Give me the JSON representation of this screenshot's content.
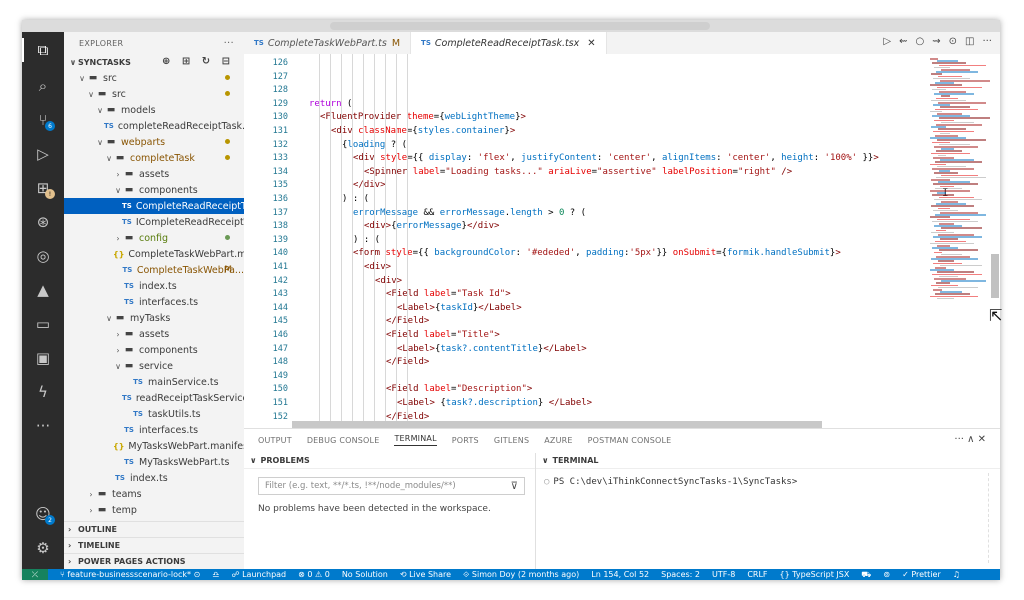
{
  "explorer": {
    "header": "EXPLORER",
    "more": "···",
    "root_label": "SYNCTASKS",
    "root_actions": "⊕ ⊞ ↻ ⊟",
    "tree": [
      {
        "label": "src",
        "depth": 1,
        "kind": "folder",
        "open": true,
        "mod": "dot"
      },
      {
        "label": "src",
        "depth": 2,
        "kind": "folder",
        "open": true,
        "mod": "dot"
      },
      {
        "label": "models",
        "depth": 3,
        "kind": "folder",
        "open": true
      },
      {
        "label": "completeReadReceiptTask.ts",
        "depth": 4,
        "kind": "ts"
      },
      {
        "label": "webparts",
        "depth": 3,
        "kind": "folder",
        "open": true,
        "mod": "dot",
        "color": "gold"
      },
      {
        "label": "completeTask",
        "depth": 4,
        "kind": "folder",
        "open": true,
        "mod": "dot",
        "color": "gold"
      },
      {
        "label": "assets",
        "depth": 5,
        "kind": "folder",
        "open": false
      },
      {
        "label": "components",
        "depth": 5,
        "kind": "folder",
        "open": true
      },
      {
        "label": "CompleteReadReceiptTas...",
        "depth": 6,
        "kind": "ts",
        "selected": true
      },
      {
        "label": "ICompleteReadReceiptTa...",
        "depth": 6,
        "kind": "ts"
      },
      {
        "label": "config",
        "depth": 5,
        "kind": "folder",
        "open": false,
        "mod": "green",
        "color": "greenish"
      },
      {
        "label": "CompleteTaskWebPart.ma...",
        "depth": 5,
        "kind": "json"
      },
      {
        "label": "CompleteTaskWebPa...",
        "depth": 5,
        "kind": "ts",
        "mod": "M",
        "color": "gold"
      },
      {
        "label": "index.ts",
        "depth": 5,
        "kind": "ts"
      },
      {
        "label": "interfaces.ts",
        "depth": 5,
        "kind": "ts"
      },
      {
        "label": "myTasks",
        "depth": 4,
        "kind": "folder",
        "open": true
      },
      {
        "label": "assets",
        "depth": 5,
        "kind": "folder",
        "open": false
      },
      {
        "label": "components",
        "depth": 5,
        "kind": "folder",
        "open": false
      },
      {
        "label": "service",
        "depth": 5,
        "kind": "folder",
        "open": true
      },
      {
        "label": "mainService.ts",
        "depth": 6,
        "kind": "ts"
      },
      {
        "label": "readReceiptTaskService.ts",
        "depth": 6,
        "kind": "ts"
      },
      {
        "label": "taskUtils.ts",
        "depth": 6,
        "kind": "ts"
      },
      {
        "label": "interfaces.ts",
        "depth": 5,
        "kind": "ts"
      },
      {
        "label": "MyTasksWebPart.manifest...",
        "depth": 5,
        "kind": "json"
      },
      {
        "label": "MyTasksWebPart.ts",
        "depth": 5,
        "kind": "ts"
      },
      {
        "label": "index.ts",
        "depth": 4,
        "kind": "ts"
      },
      {
        "label": "teams",
        "depth": 2,
        "kind": "folder",
        "open": false
      },
      {
        "label": "temp",
        "depth": 2,
        "kind": "folder",
        "open": false
      }
    ],
    "sections": [
      "OUTLINE",
      "TIMELINE",
      "POWER PAGES ACTIONS"
    ]
  },
  "tabs": [
    {
      "label": "CompleteTaskWebPart.ts",
      "badge": "TS",
      "modified": "M",
      "active": false
    },
    {
      "label": "CompleteReadReceiptTask.tsx",
      "badge": "TS",
      "close": "✕",
      "active": true
    }
  ],
  "tab_actions": [
    "▷",
    "⇜",
    "○",
    "⇝",
    "⊙",
    "◫",
    "···"
  ],
  "editor": {
    "lines": [
      {
        "n": "126",
        "indent": 0,
        "tokens": []
      },
      {
        "n": "127",
        "indent": 0,
        "tokens": []
      },
      {
        "n": "128",
        "indent": 0,
        "tokens": []
      },
      {
        "n": "129",
        "indent": 1,
        "tokens": [
          [
            "kw",
            "return"
          ],
          [
            "p",
            " ("
          ]
        ]
      },
      {
        "n": "130",
        "indent": 2,
        "tokens": [
          [
            "tag",
            "<FluentProvider"
          ],
          [
            "attr",
            " theme"
          ],
          [
            "p",
            "={"
          ],
          [
            "var",
            "webLightTheme"
          ],
          [
            "p",
            "}"
          ],
          [
            "tag",
            ">"
          ]
        ]
      },
      {
        "n": "131",
        "indent": 3,
        "tokens": [
          [
            "tag",
            "<div"
          ],
          [
            "attr",
            " className"
          ],
          [
            "p",
            "={"
          ],
          [
            "var",
            "styles.container"
          ],
          [
            "p",
            "}"
          ],
          [
            "tag",
            ">"
          ]
        ]
      },
      {
        "n": "132",
        "indent": 4,
        "tokens": [
          [
            "p",
            "{"
          ],
          [
            "var",
            "loading"
          ],
          [
            "p",
            " ? ("
          ]
        ]
      },
      {
        "n": "133",
        "indent": 5,
        "tokens": [
          [
            "tag",
            "<div"
          ],
          [
            "attr",
            " style"
          ],
          [
            "p",
            "={{ "
          ],
          [
            "var",
            "display"
          ],
          [
            "p",
            ": "
          ],
          [
            "str",
            "'flex'"
          ],
          [
            "p",
            ", "
          ],
          [
            "var",
            "justifyContent"
          ],
          [
            "p",
            ": "
          ],
          [
            "str",
            "'center'"
          ],
          [
            "p",
            ", "
          ],
          [
            "var",
            "alignItems"
          ],
          [
            "p",
            ": "
          ],
          [
            "str",
            "'center'"
          ],
          [
            "p",
            ", "
          ],
          [
            "var",
            "height"
          ],
          [
            "p",
            ": "
          ],
          [
            "str",
            "'100%'"
          ],
          [
            "p",
            " }}"
          ],
          [
            "tag",
            ">"
          ]
        ]
      },
      {
        "n": "134",
        "indent": 6,
        "tokens": [
          [
            "tag",
            "<Spinner"
          ],
          [
            "attr",
            " label"
          ],
          [
            "p",
            "="
          ],
          [
            "str",
            "\"Loading tasks...\""
          ],
          [
            "attr",
            " ariaLive"
          ],
          [
            "p",
            "="
          ],
          [
            "str",
            "\"assertive\""
          ],
          [
            "attr",
            " labelPosition"
          ],
          [
            "p",
            "="
          ],
          [
            "str",
            "\"right\""
          ],
          [
            "tag",
            " />"
          ]
        ]
      },
      {
        "n": "135",
        "indent": 5,
        "tokens": [
          [
            "tag",
            "</div>"
          ]
        ]
      },
      {
        "n": "136",
        "indent": 4,
        "tokens": [
          [
            "p",
            ") : ("
          ]
        ]
      },
      {
        "n": "137",
        "indent": 5,
        "tokens": [
          [
            "var",
            "errorMessage"
          ],
          [
            "p",
            " && "
          ],
          [
            "var",
            "errorMessage"
          ],
          [
            "p",
            "."
          ],
          [
            "var",
            "length"
          ],
          [
            "p",
            " > "
          ],
          [
            "num",
            "0"
          ],
          [
            "p",
            " ? ("
          ]
        ]
      },
      {
        "n": "138",
        "indent": 6,
        "tokens": [
          [
            "tag",
            "<div>"
          ],
          [
            "p",
            "{"
          ],
          [
            "var",
            "errorMessage"
          ],
          [
            "p",
            "}"
          ],
          [
            "tag",
            "</div>"
          ]
        ]
      },
      {
        "n": "139",
        "indent": 5,
        "tokens": [
          [
            "p",
            ") : ("
          ]
        ]
      },
      {
        "n": "140",
        "indent": 5,
        "tokens": [
          [
            "tag",
            "<form"
          ],
          [
            "attr",
            " style"
          ],
          [
            "p",
            "={{ "
          ],
          [
            "var",
            "backgroundColor"
          ],
          [
            "p",
            ": "
          ],
          [
            "str",
            "'#ededed'"
          ],
          [
            "p",
            ", "
          ],
          [
            "var",
            "padding"
          ],
          [
            "p",
            ":"
          ],
          [
            "str",
            "'5px'"
          ],
          [
            "p",
            "}}"
          ],
          [
            "attr",
            " onSubmit"
          ],
          [
            "p",
            "={"
          ],
          [
            "var",
            "formik.handleSubmit"
          ],
          [
            "p",
            "}"
          ],
          [
            "tag",
            ">"
          ]
        ]
      },
      {
        "n": "141",
        "indent": 6,
        "tokens": [
          [
            "tag",
            "<div>"
          ]
        ]
      },
      {
        "n": "142",
        "indent": 7,
        "tokens": [
          [
            "tag",
            "<div>"
          ]
        ]
      },
      {
        "n": "143",
        "indent": 8,
        "tokens": [
          [
            "tag",
            "<Field"
          ],
          [
            "attr",
            " label"
          ],
          [
            "p",
            "="
          ],
          [
            "str",
            "\"Task Id\""
          ],
          [
            "tag",
            ">"
          ]
        ]
      },
      {
        "n": "144",
        "indent": 9,
        "tokens": [
          [
            "tag",
            "<Label>"
          ],
          [
            "p",
            "{"
          ],
          [
            "var",
            "taskId"
          ],
          [
            "p",
            "}"
          ],
          [
            "tag",
            "</Label>"
          ]
        ]
      },
      {
        "n": "145",
        "indent": 8,
        "tokens": [
          [
            "tag",
            "</Field>"
          ]
        ]
      },
      {
        "n": "146",
        "indent": 8,
        "tokens": [
          [
            "tag",
            "<Field"
          ],
          [
            "attr",
            " label"
          ],
          [
            "p",
            "="
          ],
          [
            "str",
            "\"Title\""
          ],
          [
            "tag",
            ">"
          ]
        ]
      },
      {
        "n": "147",
        "indent": 9,
        "tokens": [
          [
            "tag",
            "<Label>"
          ],
          [
            "p",
            "{"
          ],
          [
            "var",
            "task?.contentTitle"
          ],
          [
            "p",
            "}"
          ],
          [
            "tag",
            "</Label>"
          ]
        ]
      },
      {
        "n": "148",
        "indent": 8,
        "tokens": [
          [
            "tag",
            "</Field>"
          ]
        ]
      },
      {
        "n": "149",
        "indent": 0,
        "tokens": []
      },
      {
        "n": "150",
        "indent": 8,
        "tokens": [
          [
            "tag",
            "<Field"
          ],
          [
            "attr",
            " label"
          ],
          [
            "p",
            "="
          ],
          [
            "str",
            "\"Description\""
          ],
          [
            "tag",
            ">"
          ]
        ]
      },
      {
        "n": "151",
        "indent": 9,
        "tokens": [
          [
            "tag",
            "<Label>"
          ],
          [
            "p",
            " {"
          ],
          [
            "var",
            "task?.description"
          ],
          [
            "p",
            "} "
          ],
          [
            "tag",
            "</Label>"
          ]
        ]
      },
      {
        "n": "152",
        "indent": 8,
        "tokens": [
          [
            "tag",
            "</Field>"
          ]
        ]
      }
    ]
  },
  "panel": {
    "tabs": [
      "OUTPUT",
      "DEBUG CONSOLE",
      "TERMINAL",
      "PORTS",
      "GITLENS",
      "AZURE",
      "POSTMAN CONSOLE"
    ],
    "active_tab": "TERMINAL",
    "actions": "··· ∧ ✕",
    "problems_header": "PROBLEMS",
    "filter_placeholder": "Filter (e.g. text, **/*.ts, !**/node_modules/**)",
    "filter_icon": "⊽",
    "no_problems": "No problems have been detected in the workspace.",
    "terminal_header": "TERMINAL",
    "terminal_prompt": "PS C:\\dev\\iThinkConnectSyncTasks-1\\SyncTasks>"
  },
  "statusbar": {
    "remote": "⤫",
    "items": [
      "⑂ feature-businessscenario-lock* ⊙",
      "♎",
      "☍ Launchpad",
      "⊗ 0 ⚠ 0",
      "No Solution",
      "⟲ Live Share",
      "⟐ Simon Doy (2 months ago)",
      "Ln 154, Col 52",
      "Spaces: 2",
      "UTF-8",
      "CRLF",
      "{} TypeScript JSX",
      "⛟",
      "⊚",
      "✓ Prettier",
      "♫"
    ]
  },
  "colors": {
    "activity_bg": "#2c2c2c",
    "statusbar": "#007acc",
    "selection": "#0060c0",
    "keyword": "#af00db",
    "tag": "#800000",
    "attr": "#e50000",
    "string": "#a31515",
    "variable": "#0070c1"
  },
  "activity_icons": [
    "files-icon",
    "search-icon",
    "source-control-icon",
    "run-debug-icon",
    "extensions-icon",
    "remote-icon",
    "gitlens-icon",
    "azure-icon",
    "remote-explorer-icon",
    "docker-icon",
    "power-platform-icon",
    "more-icon",
    "accounts-icon",
    "settings-icon"
  ],
  "activity_badges": {
    "source-control-icon": "6",
    "extensions-icon": "",
    "accounts-icon": "2"
  }
}
